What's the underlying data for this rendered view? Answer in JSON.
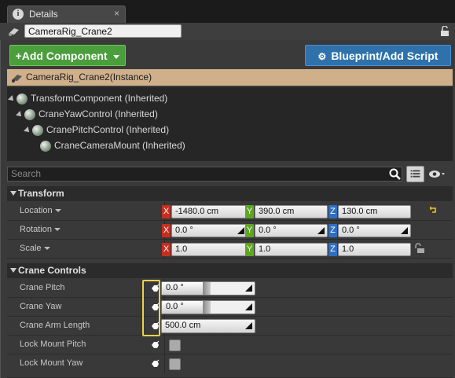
{
  "tab": {
    "icon": "info-icon",
    "title": "Details",
    "close": "×"
  },
  "actor_name": "CameraRig_Crane2",
  "buttons": {
    "add_component": "Add Component",
    "add_prefix": "+",
    "blueprint": "Blueprint/Add Script"
  },
  "instance_label": "CameraRig_Crane2(Instance)",
  "tree": [
    {
      "label": "TransformComponent (Inherited)",
      "depth": 0
    },
    {
      "label": "CraneYawControl (Inherited)",
      "depth": 1
    },
    {
      "label": "CranePitchControl (Inherited)",
      "depth": 2
    },
    {
      "label": "CraneCameraMount (Inherited)",
      "depth": 3
    }
  ],
  "search": {
    "placeholder": "Search"
  },
  "transform": {
    "title": "Transform",
    "rows": [
      {
        "label": "Location",
        "x": "-1480.0 cm",
        "y": "390.0 cm",
        "z": "130.0 cm"
      },
      {
        "label": "Rotation",
        "x": "0.0 °",
        "y": "0.0 °",
        "z": "0.0 °"
      },
      {
        "label": "Scale",
        "x": "1.0",
        "y": "1.0",
        "z": "1.0"
      }
    ],
    "axis": {
      "x": "X",
      "y": "Y",
      "z": "Z"
    }
  },
  "crane": {
    "title": "Crane Controls",
    "rows": [
      {
        "label": "Crane Pitch",
        "value": "0.0 °"
      },
      {
        "label": "Crane Yaw",
        "value": "0.0 °"
      },
      {
        "label": "Crane Arm Length",
        "value": "500.0 cm"
      },
      {
        "label": "Lock Mount Pitch",
        "checked": false
      },
      {
        "label": "Lock Mount Yaw",
        "checked": false
      }
    ]
  },
  "colors": {
    "add": "#4a9e3c",
    "blueprint": "#2f72ab",
    "instance": "#cfb08b",
    "x": "#c82d1f",
    "y": "#5da622",
    "z": "#2f6fc3",
    "highlight": "#e8d34a"
  }
}
